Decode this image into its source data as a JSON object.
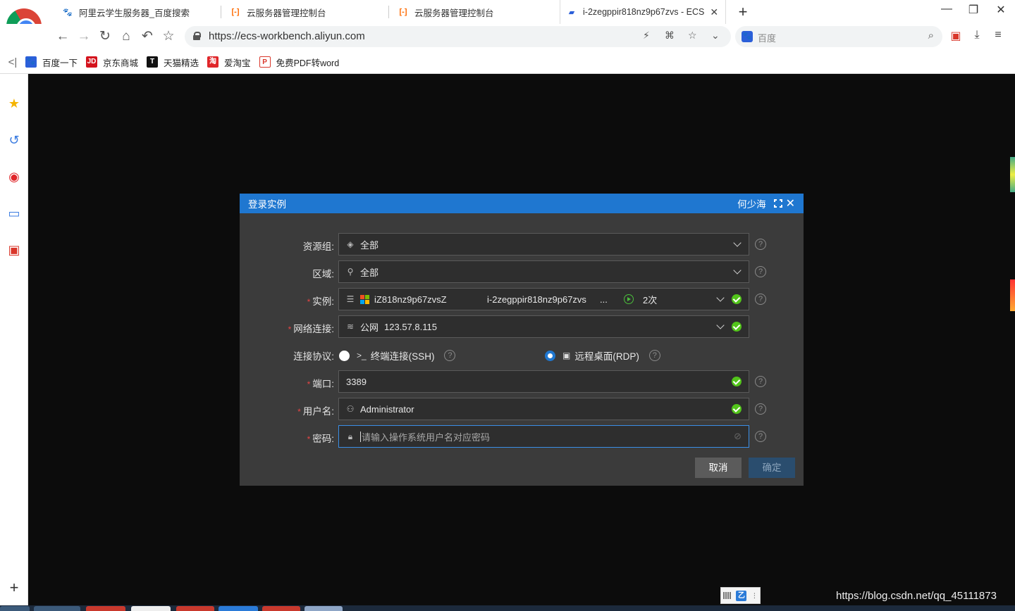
{
  "browser": {
    "tabs": [
      {
        "title": "阿里云学生服务器_百度搜索",
        "icon": "baidu-paw-icon"
      },
      {
        "title": "云服务器管理控制台",
        "icon": "aliyun-bracket-icon"
      },
      {
        "title": "云服务器管理控制台",
        "icon": "aliyun-bracket-icon"
      },
      {
        "title": "i-2zegppir818nz9p67zvs - ECS",
        "icon": "remote-desktop-icon",
        "active": true
      }
    ],
    "new_tab": "+",
    "url": "https://ecs-workbench.aliyun.com",
    "search_placeholder": "百度",
    "bookmarks": [
      "百度一下",
      "京东商城",
      "天猫精选",
      "爱淘宝",
      "免费PDF转word"
    ]
  },
  "dialog": {
    "title": "登录实例",
    "user": "何少海",
    "resource_group": {
      "label": "资源组:",
      "value": "全部"
    },
    "region": {
      "label": "区域:",
      "value": "全部"
    },
    "instance": {
      "label": "实例:",
      "name": "iZ818nz9p67zvsZ",
      "id": "i-2zegppir818nz9p67zvs",
      "ellipsis": "...",
      "count": "2次"
    },
    "network": {
      "label": "网络连接:",
      "type": "公网",
      "ip": "123.57.8.115"
    },
    "protocol": {
      "label": "连接协议:",
      "ssh": "终端连接(SSH)",
      "rdp": "远程桌面(RDP)",
      "selected": "rdp"
    },
    "port": {
      "label": "端口:",
      "value": "3389"
    },
    "username": {
      "label": "用户名:",
      "value": "Administrator"
    },
    "password": {
      "label": "密码:",
      "placeholder": "请输入操作系统用户名对应密码"
    },
    "cancel_label": "取消",
    "confirm_label": "确定",
    "required_mark": "*",
    "help_mark": "?"
  },
  "watermark": "https://blog.csdn.net/qq_45111873",
  "colors": {
    "dialog_header": "#1f77d0",
    "dialog_bg": "#3b3b3b",
    "success": "#52c41a",
    "required": "#e54545"
  }
}
